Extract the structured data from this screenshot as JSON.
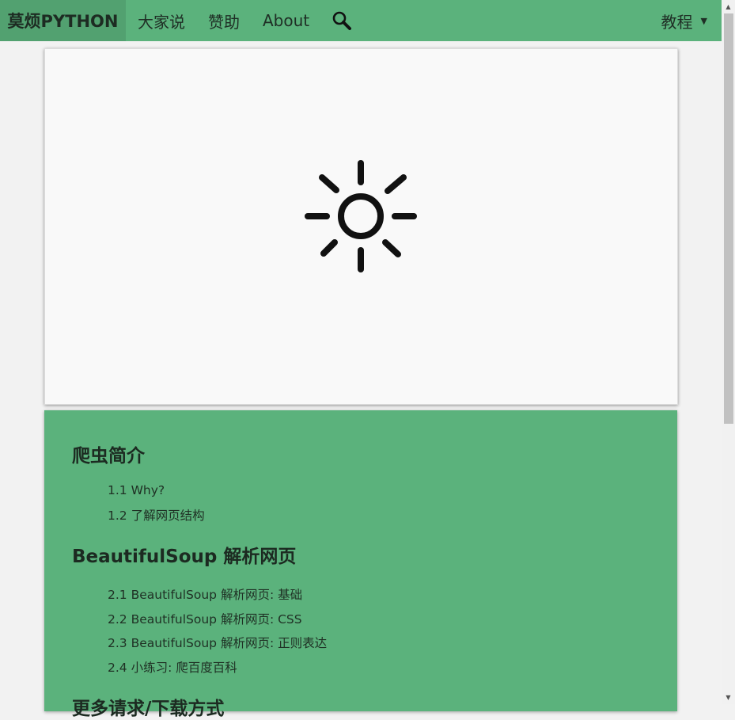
{
  "navbar": {
    "brand": "莫烦PYTHON",
    "items": [
      "大家说",
      "赞助",
      "About"
    ],
    "tutorial": "教程",
    "caret": "▼"
  },
  "hero": {
    "icon": "sun-icon"
  },
  "toc": {
    "sections": [
      {
        "title": "爬虫简介",
        "links": [
          "1.1 Why?",
          "1.2 了解网页结构"
        ]
      },
      {
        "title": "BeautifulSoup 解析网页",
        "links": [
          "2.1 BeautifulSoup 解析网页: 基础",
          "2.2 BeautifulSoup 解析网页: CSS",
          "2.3 BeautifulSoup 解析网页: 正则表达",
          "2.4 小练习: 爬百度百科"
        ]
      },
      {
        "title": "更多请求/下载方式",
        "links": []
      }
    ]
  },
  "scrollbar": {
    "up": "▲",
    "down": "▼"
  },
  "colors": {
    "nav": "#5bb27c",
    "brand_bg": "#52a170",
    "page_bg": "#f2f2f2"
  }
}
